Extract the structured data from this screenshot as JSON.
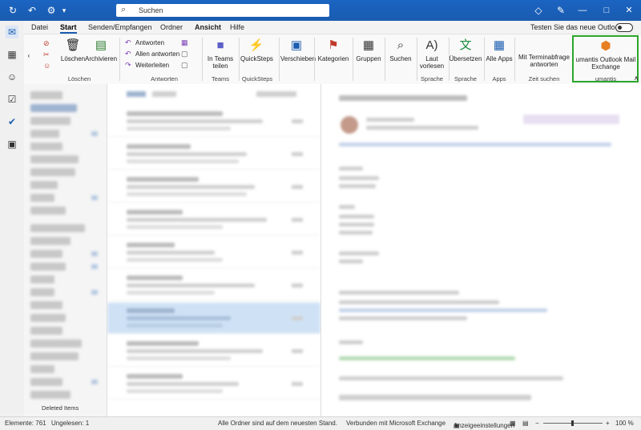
{
  "titlebar": {
    "search_placeholder": "Suchen"
  },
  "menu": {
    "tabs": [
      "Datei",
      "Start",
      "Senden/Empfangen",
      "Ordner",
      "Ansicht",
      "Hilfe"
    ],
    "active": "Start",
    "new_outlook_label": "Testen Sie das neue Outlook"
  },
  "ribbon": {
    "delete_group": {
      "label": "Löschen",
      "delete": "Löschen",
      "archive": "Archivieren"
    },
    "respond_group": {
      "label": "Antworten",
      "reply": "Antworten",
      "reply_all": "Allen antworten",
      "forward": "Weiterleiten"
    },
    "teams_group": {
      "label": "Teams",
      "share": "In Teams teilen"
    },
    "quicksteps_group": {
      "label": "QuickSteps",
      "button": "QuickSteps"
    },
    "move": {
      "label": "Verschieben"
    },
    "categories": {
      "label": "Kategorien"
    },
    "groups": {
      "label": "Gruppen"
    },
    "search": {
      "label": "Suchen"
    },
    "speech_group": {
      "label": "Sprache",
      "read_aloud": "Laut vorlesen"
    },
    "language_group": {
      "label": "Sprache",
      "translate": "Übersetzen"
    },
    "apps_group": {
      "label": "Apps",
      "all_apps": "Alle Apps"
    },
    "find_time_group": {
      "label": "Zeit suchen",
      "reply_meeting": "Mit Terminabfrage antworten"
    },
    "umantis_group": {
      "label": "umantis",
      "button": "umantis Outlook Mail Exchange"
    }
  },
  "folderpane": {
    "visible_items": [
      "Deleted Items"
    ]
  },
  "statusbar": {
    "elements": "Elemente: 761",
    "unread": "Ungelesen: 1",
    "all_folders": "Alle Ordner sind auf dem neuesten Stand.",
    "connected": "Verbunden mit Microsoft Exchange",
    "display_settings": "Anzeigeeinstellungen",
    "zoom": "100 %"
  },
  "colors": {
    "titlebar": "#1a5cb0",
    "accent": "#1a5cb0",
    "highlight": "#2ca52c"
  }
}
